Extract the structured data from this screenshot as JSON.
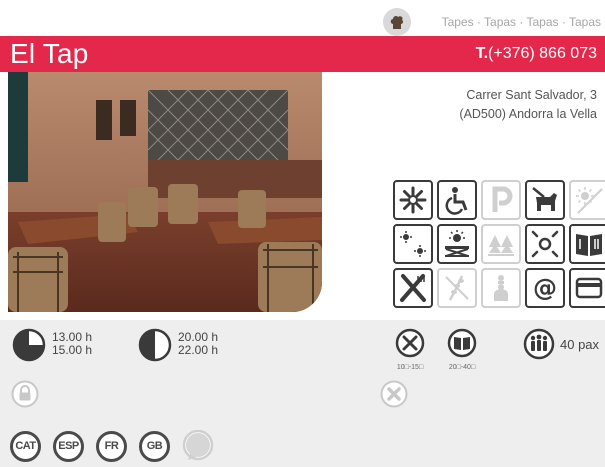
{
  "category_bar": {
    "text": "Tapes · Tapas · Tapas · Tapas"
  },
  "header": {
    "name": "El Tap",
    "phone_prefix": "T.",
    "phone_number": "(+376) 866 073"
  },
  "address": {
    "line1": "Carrer Sant Salvador, 3",
    "line2": "(AD500) Andorra la Vella"
  },
  "amenities": [
    {
      "name": "air-conditioning-icon",
      "enabled": true
    },
    {
      "name": "wheelchair-access-icon",
      "enabled": true
    },
    {
      "name": "parking-icon",
      "enabled": false
    },
    {
      "name": "pets-allowed-icon",
      "enabled": true
    },
    {
      "name": "terrace-sun-icon",
      "enabled": false
    },
    {
      "name": "heating-icon",
      "enabled": true
    },
    {
      "name": "sun-terrace-icon",
      "enabled": true
    },
    {
      "name": "mountain-views-icon",
      "enabled": false
    },
    {
      "name": "kids-area-icon",
      "enabled": true
    },
    {
      "name": "menu-card-icon",
      "enabled": true
    },
    {
      "name": "cutlery-icon",
      "enabled": true
    },
    {
      "name": "gluten-free-icon",
      "enabled": false
    },
    {
      "name": "chef-icon",
      "enabled": false
    },
    {
      "name": "email-icon",
      "enabled": true
    },
    {
      "name": "credit-card-icon",
      "enabled": true
    }
  ],
  "hours": {
    "lunch": {
      "open": "13.00 h",
      "close": "15.00 h"
    },
    "dinner": {
      "open": "20.00 h",
      "close": "22.00 h"
    }
  },
  "prices": {
    "menu": "10□-15□",
    "carte": "20□-40□"
  },
  "capacity": "40 pax",
  "languages": [
    "CAT",
    "ESP",
    "FR",
    "GB"
  ],
  "colors": {
    "brand": "#e4284c",
    "panel": "#eeeeee",
    "icon": "#3a3a3a",
    "disabled": "#cfcfcf"
  }
}
